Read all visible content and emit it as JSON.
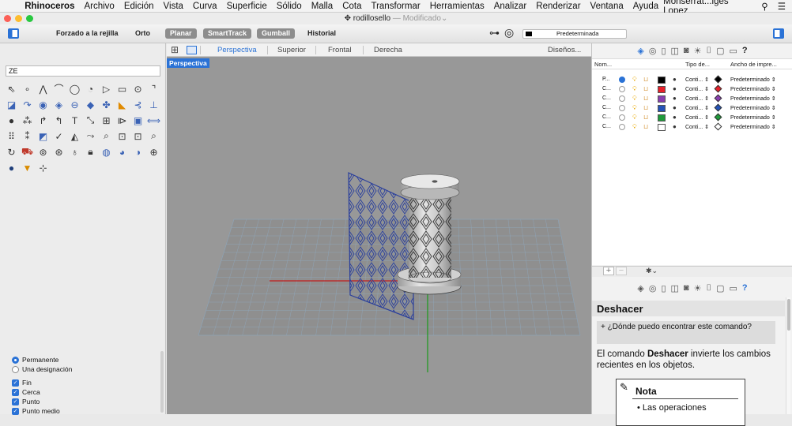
{
  "menubar": {
    "app": "Rhinoceros",
    "items": [
      "Archivo",
      "Edición",
      "Vista",
      "Curva",
      "Superficie",
      "Sólido",
      "Malla",
      "Cota",
      "Transformar",
      "Herramientas",
      "Analizar",
      "Renderizar",
      "Ventana",
      "Ayuda"
    ],
    "user": "Monserrat...iges Lopez"
  },
  "window": {
    "title": "rodillosello",
    "status": "— Modificado"
  },
  "toolbar": {
    "snap_grid": "Forzado a la rejilla",
    "ortho": "Orto",
    "planar": "Planar",
    "smarttrack": "SmartTrack",
    "gumball": "Gumball",
    "history": "Historial",
    "current_layer": "Predeterminada"
  },
  "viewport_tabs": {
    "tabs": [
      "Perspectiva",
      "Superior",
      "Frontal",
      "Derecha"
    ],
    "active": "Perspectiva",
    "more": "Diseños..."
  },
  "viewport": {
    "label": "Perspectiva"
  },
  "command": {
    "input": "ZE"
  },
  "osnap": {
    "mode_on": "Permanente",
    "mode_off": "Una designación",
    "checks": [
      "Fin",
      "Cerca",
      "Punto",
      "Punto medio"
    ]
  },
  "layers": {
    "headers": {
      "name": "Nom...",
      "linetype": "Tipo de...",
      "print_width": "Ancho de impre..."
    },
    "rows": [
      {
        "name": "P...",
        "current": true,
        "color": "#000000",
        "linetype": "Conti...",
        "print_width": "Predeterminado"
      },
      {
        "name": "C...",
        "current": false,
        "color": "#e8202a",
        "linetype": "Conti...",
        "print_width": "Predeterminado"
      },
      {
        "name": "C...",
        "current": false,
        "color": "#8a3fb0",
        "linetype": "Conti...",
        "print_width": "Predeterminado"
      },
      {
        "name": "C...",
        "current": false,
        "color": "#2453b8",
        "linetype": "Conti...",
        "print_width": "Predeterminado"
      },
      {
        "name": "C...",
        "current": false,
        "color": "#1f9a3b",
        "linetype": "Conti...",
        "print_width": "Predeterminado"
      },
      {
        "name": "C...",
        "current": false,
        "color": "#ffffff",
        "linetype": "Conti...",
        "print_width": "Predeterminado"
      }
    ]
  },
  "help": {
    "title": "Deshacer",
    "question": "+ ¿Dónde puedo encontrar este comando?",
    "body_prefix": "El comando ",
    "body_bold": "Deshacer",
    "body_rest": " invierte los cambios recientes en los objetos.",
    "note_title": "Nota",
    "note_bullet": "Las operaciones"
  }
}
